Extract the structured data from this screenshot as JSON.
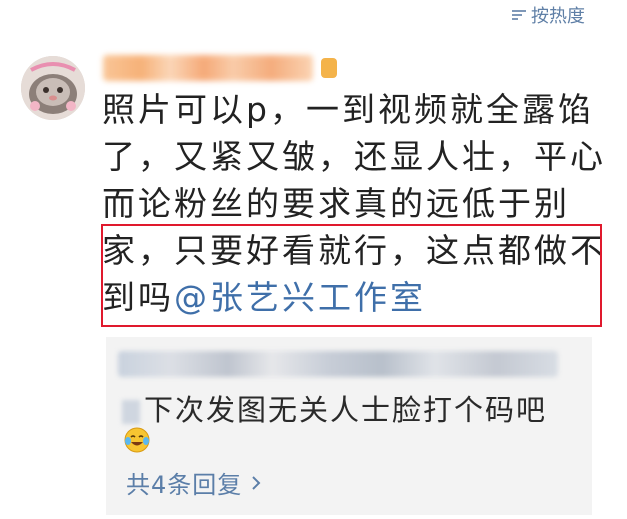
{
  "header": {
    "sort_label": "按热度"
  },
  "comment": {
    "author_name_blurred": "",
    "lines": [
      "照片可以p，一到视频就全露馅",
      "了，又紧又皱，还显人壮，平心",
      "而论粉丝的要求真的远低于别",
      "家，只要好看就行，这点都做不"
    ],
    "last_line_prefix": "到吗",
    "mention": "@张艺兴工作室"
  },
  "replies": {
    "reply_text": "下次发图无关人士脸打个码吧",
    "total_label": "共4条回复"
  },
  "colors": {
    "accent_link": "#3f6fa9",
    "highlight_border": "#e0192d",
    "reply_panel_bg": "#f3f3f3"
  },
  "icons": {
    "sort": "sort-icon",
    "emoji": "laughing-tears-emoji-icon",
    "chevron": "chevron-right-icon"
  }
}
